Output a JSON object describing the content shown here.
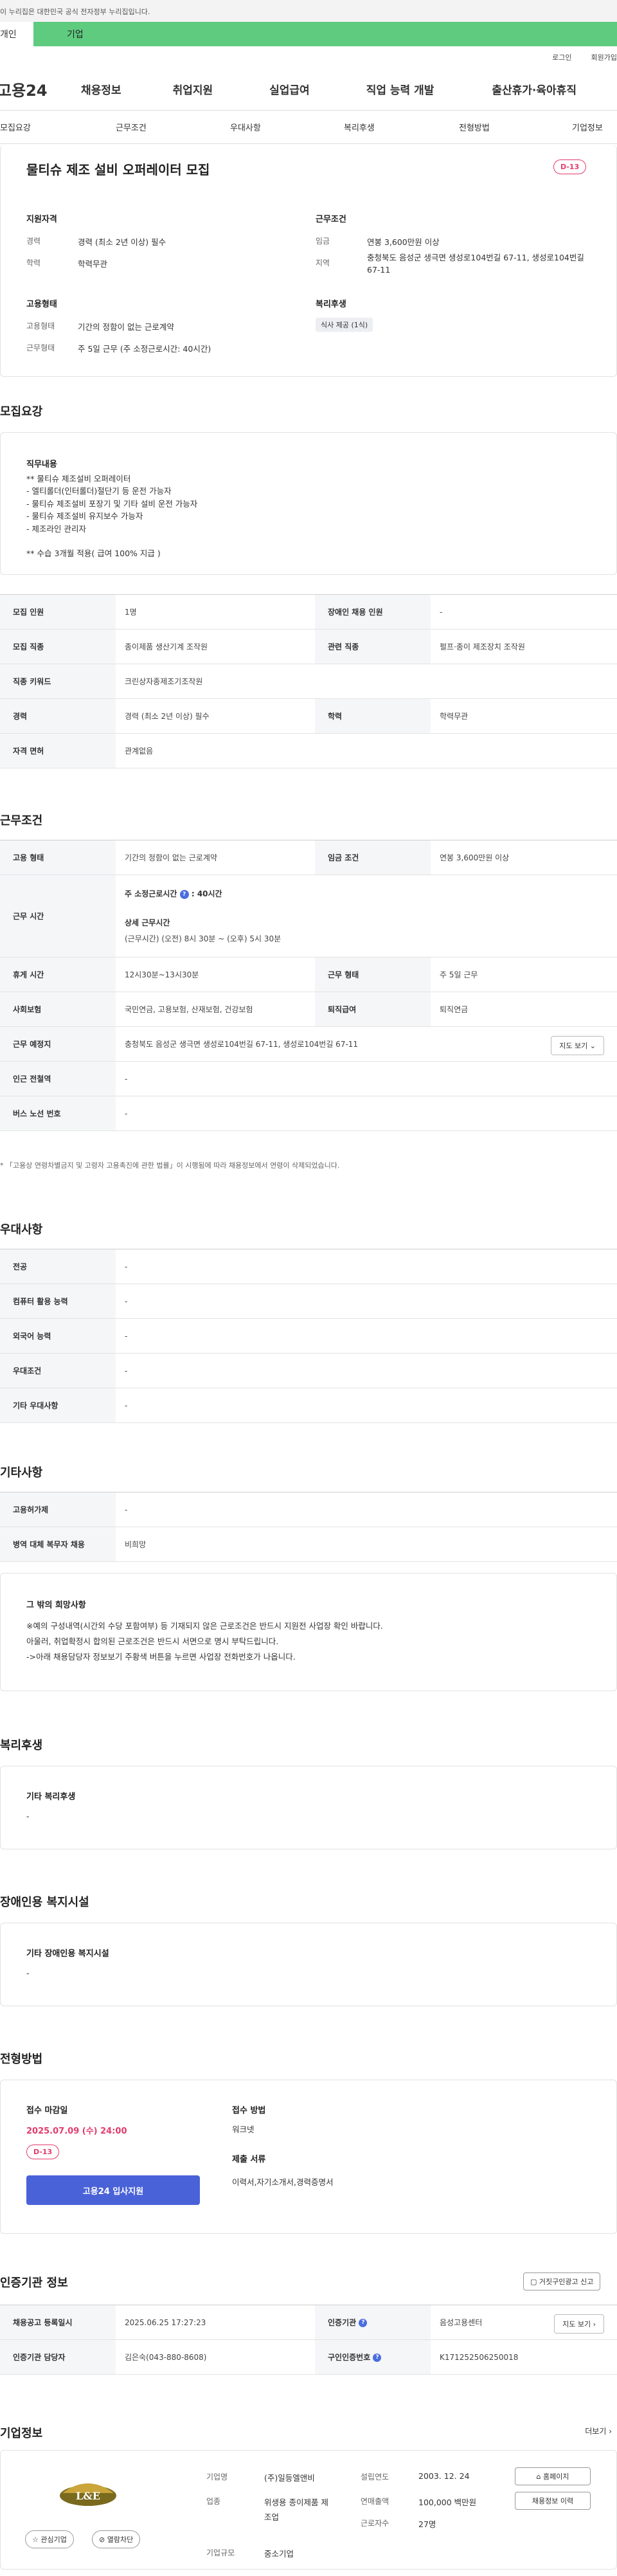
{
  "topbar": {
    "notice": "이 누리집은 대한민국 공식 전자정부 누리집입니다."
  },
  "tabs": {
    "personal": "개인",
    "company": "기업"
  },
  "util": {
    "login": "로그인",
    "signup": "회원가입"
  },
  "gnb": {
    "logo": "고용24",
    "menu": [
      "채용정보",
      "취업지원",
      "실업급여",
      "직업 능력 개발",
      "출산휴가·육아휴직"
    ]
  },
  "subnav": [
    "모집요강",
    "근무조건",
    "우대사항",
    "복리후생",
    "전형방법",
    "기업정보"
  ],
  "summary": {
    "title": "물티슈 제조 설비 오퍼레이터 모집",
    "dday": "D-13",
    "qual_h": "지원자격",
    "career_l": "경력",
    "career_v": "경력 (최소 2년 이상) 필수",
    "edu_l": "학력",
    "edu_v": "학력무관",
    "cond_h": "근무조건",
    "wage_l": "임금",
    "wage_v": "연봉 3,600만원 이상",
    "area_l": "지역",
    "area_v": "충청북도 음성군 생극면 생성로104번길 67-11, 생성로104번길 67-11",
    "emp_h": "고용형태",
    "emptype_l": "고용형태",
    "emptype_v": "기간의 정함이 없는 근로계약",
    "worktype_l": "근무형태",
    "worktype_v": "주 5일 근무 (주 소정근로시간: 40시간)",
    "welfare_h": "복리후생",
    "welfare_chip": "식사 제공 (1식)"
  },
  "recruit": {
    "title": "모집요강",
    "duty_h": "직무내용",
    "duty_text": "** 물티슈 제조설비 오퍼레이터\n- 엘티롤더(인터롤더)절단기 등 운전 가능자\n- 물티슈 제조설비 포장기 및 기타 설비 운전 가능자\n- 물티슈 제조설비 유지보수 가능자\n- 제조라인 관리자\n\n** 수습 3개월 적용( 급여 100% 지급 )",
    "rows": [
      {
        "k1": "모집 인원",
        "v1": "1명",
        "k2": "장애인 채용 인원",
        "v2": "-"
      },
      {
        "k1": "모집 직종",
        "v1": "종이제품 생산기계 조작원",
        "k2": "관련 직종",
        "v2": "펄프·종이 제조장치 조작원"
      },
      {
        "k1": "직종 키워드",
        "v1": "크린상자종제조기조작원"
      },
      {
        "k1": "경력",
        "v1": "경력 (최소 2년 이상) 필수",
        "k2": "학력",
        "v2": "학력무관"
      },
      {
        "k1": "자격 면허",
        "v1": "관계없음"
      }
    ]
  },
  "workcond": {
    "title": "근무조건",
    "emp_k": "고용 형태",
    "emp_v": "기간의 정함이 없는 근로계약",
    "wage_k": "임금 조건",
    "wage_v": "연봉 3,600만원 이상",
    "hours_k": "근무 시간",
    "hours_main": "주 소정근로시간",
    "hours_val": ": 40시간",
    "hours_detail_h": "상세 근무시간",
    "hours_detail": "(근무시간) (오전) 8시 30분 ~ (오후) 5시 30분",
    "break_k": "휴게 시간",
    "break_v": "12시30분~13시30분",
    "form_k": "근무 형태",
    "form_v": "주 5일 근무",
    "ins_k": "사회보험",
    "ins_v": "국민연금, 고용보험, 산재보험, 건강보험",
    "sev_k": "퇴직급여",
    "sev_v": "퇴직연금",
    "place_k": "근무 예정지",
    "place_v": "충청북도 음성군 생극면 생성로104번길 67-11, 생성로104번길 67-11",
    "map_btn": "지도 보기",
    "sub_k": "인근 전철역",
    "sub_v": "-",
    "bus_k": "버스 노선 번호",
    "bus_v": "-",
    "note": "* 「고용상 연령차별금지 및 고령자 고용촉진에 관한 법률」이 시행됨에 따라 채용정보에서 연령이 삭제되었습니다."
  },
  "pref": {
    "title": "우대사항",
    "rows": [
      {
        "k": "전공",
        "v": "-"
      },
      {
        "k": "컴퓨터 활용 능력",
        "v": "-"
      },
      {
        "k": "외국어 능력",
        "v": "-"
      },
      {
        "k": "우대조건",
        "v": "-"
      },
      {
        "k": "기타 우대사항",
        "v": "-"
      }
    ]
  },
  "etc": {
    "title": "기타사항",
    "rows": [
      {
        "k": "고용허가제",
        "v": "-"
      },
      {
        "k": "병역 대체 복무자 채용",
        "v": "비희망"
      }
    ],
    "box_h": "그 밖의 희망사항",
    "box_text": "※예의 구성내역(시간외 수당 포함여부) 등 기재되지 않은 근로조건은 반드시 지원전 사업장 확인 바랍니다.\n아울러, 취업확정시 합의된 근로조건은 반드시 서면으로 명시 부탁드립니다.\n->아래 채용담당자 정보보기 주황색 버튼을 누르면 사업장 전화번호가 나옵니다."
  },
  "welfare": {
    "title": "복리후생",
    "box_h": "기타 복리후생",
    "box_v": "-"
  },
  "disab": {
    "title": "장애인용 복지시설",
    "box_h": "기타 장애인용 복지시설",
    "box_v": "-"
  },
  "selection": {
    "title": "전형방법",
    "deadline_h": "접수 마감일",
    "deadline_v": "2025.07.09 (수) 24:00",
    "dday": "D-13",
    "apply_btn": "고용24 입사지원",
    "method_h": "접수 방법",
    "method_v": "워크넷",
    "docs_h": "제출 서류",
    "docs_v": "이력서,자기소개서,경력증명서"
  },
  "cert": {
    "title": "인증기관 정보",
    "report_btn": "거짓구인광고 신고",
    "reg_k": "채용공고 등록일시",
    "reg_v": "2025.06.25 17:27:23",
    "org_k": "인증기관",
    "org_v": "음성고용센터",
    "map_btn": "지도 보기",
    "mgr_k": "인증기관 담당자",
    "mgr_v": "김은숙(043-880-8608)",
    "num_k": "구인인증번호",
    "num_v": "K171252506250018"
  },
  "company": {
    "title": "기업정보",
    "more": "더보기",
    "logo_text": "L&E",
    "fav_btn": "관심기업",
    "block_btn": "열람차단",
    "name_l": "기업명",
    "name_v": "(주)일등엘앤비",
    "ind_l": "업종",
    "ind_v": "위생용 종이제품 제조업",
    "size_l": "기업규모",
    "size_v": "중소기업",
    "est_l": "설립연도",
    "est_v": "2003. 12. 24",
    "sales_l": "연매출액",
    "sales_v": "100,000 백만원",
    "emp_l": "근로자수",
    "emp_v": "27명",
    "home_btn": "홈페이지",
    "jobs_btn": "채용정보 이력"
  }
}
